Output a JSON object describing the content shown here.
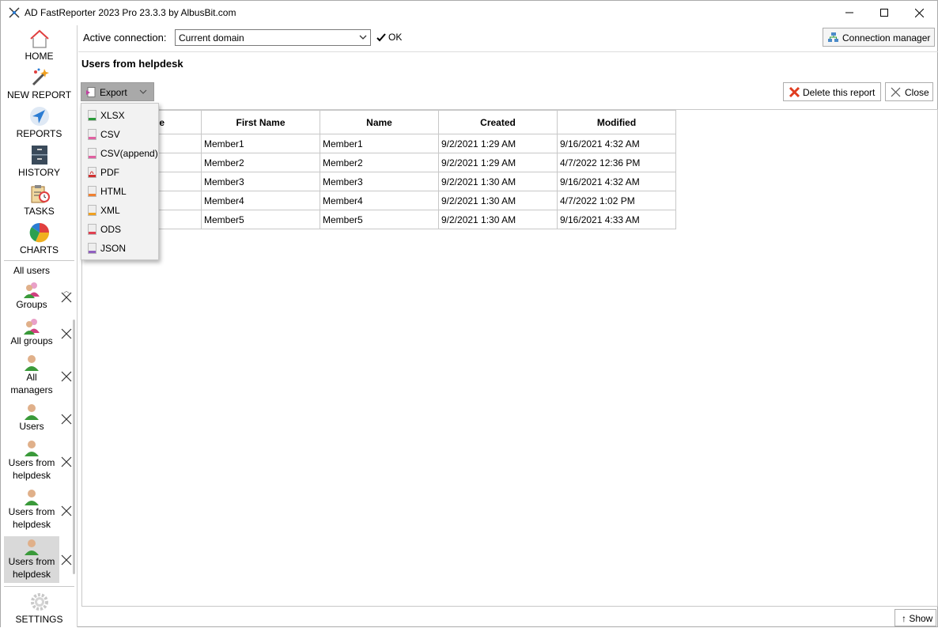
{
  "window": {
    "title": "AD FastReporter 2023 Pro 23.3.3 by AlbusBit.com"
  },
  "nav": [
    {
      "label": "HOME",
      "icon": "home-icon"
    },
    {
      "label": "NEW REPORT",
      "icon": "magic-wand-icon"
    },
    {
      "label": "REPORTS",
      "icon": "navigation-arrow-icon"
    },
    {
      "label": "HISTORY",
      "icon": "file-cabinet-icon"
    },
    {
      "label": "TASKS",
      "icon": "clipboard-clock-icon"
    },
    {
      "label": "CHARTS",
      "icon": "pie-chart-icon"
    }
  ],
  "sidebar": {
    "open_reports": [
      {
        "label": "All users"
      },
      {
        "label": "Groups"
      },
      {
        "label": "All groups"
      },
      {
        "label": "All managers"
      },
      {
        "label": "Users"
      },
      {
        "label": "Users from helpdesk"
      },
      {
        "label": "Users from helpdesk"
      },
      {
        "label": "Users from helpdesk",
        "selected": true
      }
    ],
    "settings_label": "SETTINGS"
  },
  "connection": {
    "label": "Active connection:",
    "selected": "Current domain",
    "status": "OK",
    "manager_button": "Connection manager"
  },
  "report": {
    "title": "Users from helpdesk",
    "export_label": "Export",
    "delete_label": "Delete this report",
    "close_label": "Close"
  },
  "export_menu": [
    "XLSX",
    "CSV",
    "CSV(append)",
    "PDF",
    "HTML",
    "XML",
    "ODS",
    "JSON"
  ],
  "grid": {
    "headers": [
      "e",
      "First Name",
      "Name",
      "Created",
      "Modified"
    ],
    "rows": [
      [
        "",
        "Member1",
        "Member1",
        "9/2/2021 1:29 AM",
        "9/16/2021 4:32 AM"
      ],
      [
        "",
        "Member2",
        "Member2",
        "9/2/2021 1:29 AM",
        "4/7/2022 12:36 PM"
      ],
      [
        "",
        "Member3",
        "Member3",
        "9/2/2021 1:30 AM",
        "9/16/2021 4:32 AM"
      ],
      [
        "",
        "Member4",
        "Member4",
        "9/2/2021 1:30 AM",
        "4/7/2022 1:02 PM"
      ],
      [
        "",
        "Member5",
        "Member5",
        "9/2/2021 1:30 AM",
        "9/16/2021 4:33 AM"
      ]
    ]
  },
  "footer": {
    "show_label": "↑ Show"
  },
  "colors": {
    "accent_blue": "#2b7cd3",
    "delete_red": "#e03c1f",
    "selected_bg": "#d9d9d9"
  }
}
